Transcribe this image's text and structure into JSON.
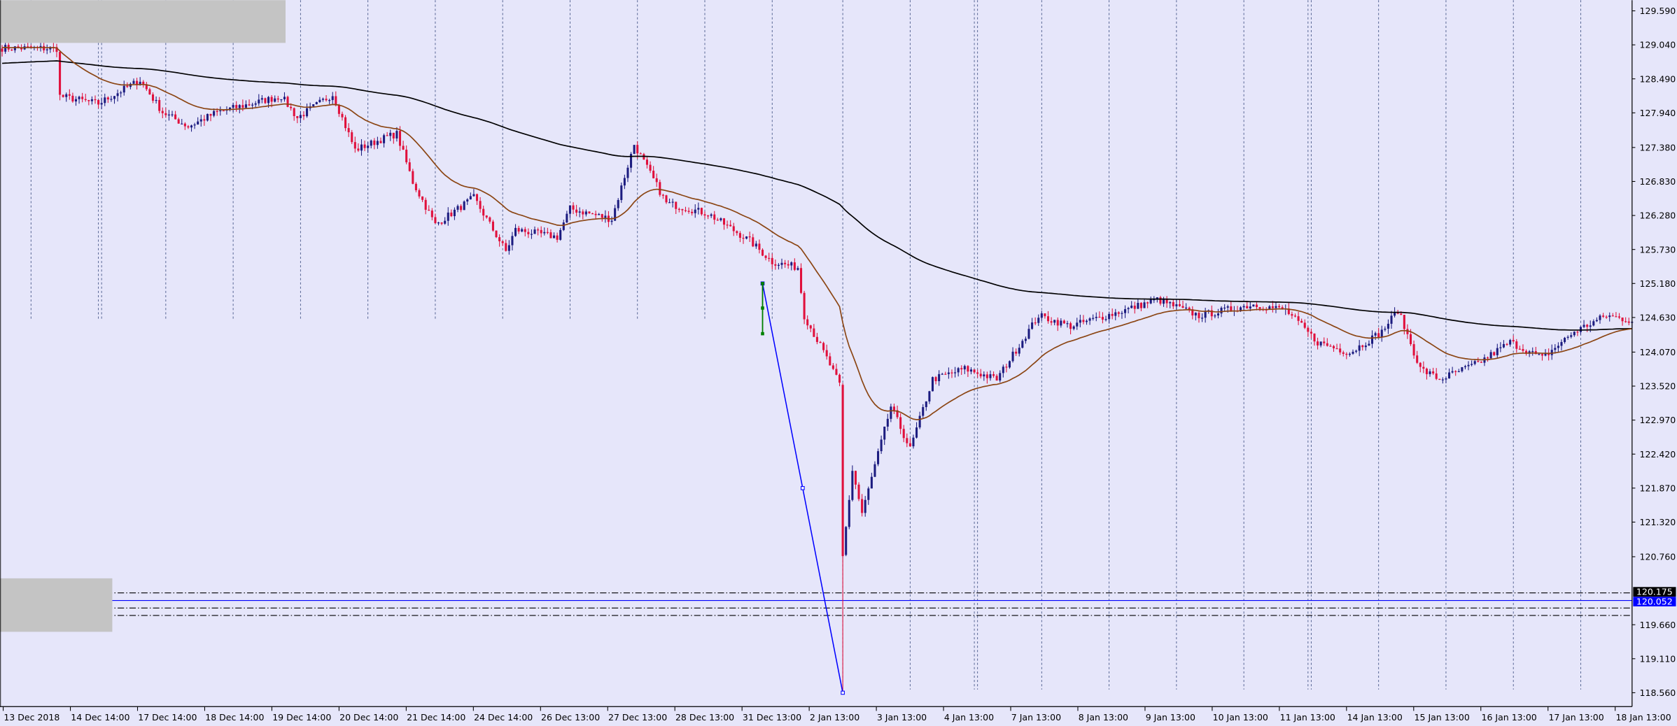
{
  "chart_data": {
    "type": "candlestick",
    "title": "",
    "colors": {
      "background": "#e6e6fa",
      "bull": "#1c1c80",
      "bear": "#e0103c",
      "ma_fast": "#8b4513",
      "ma_slow": "#000000",
      "trendline": "#0000ff",
      "marker": "#008000",
      "badge_black": "#000000",
      "badge_blue": "#0000ff"
    },
    "ylim": [
      118.56,
      129.59
    ],
    "y_ticks": [
      "129.590",
      "129.040",
      "128.490",
      "127.940",
      "127.380",
      "126.830",
      "126.280",
      "125.730",
      "125.180",
      "124.630",
      "124.070",
      "123.520",
      "122.970",
      "122.420",
      "121.870",
      "121.320",
      "120.760",
      "119.660",
      "119.110",
      "118.560"
    ],
    "x_ticks": [
      "13 Dec 2018",
      "14 Dec 14:00",
      "17 Dec 14:00",
      "18 Dec 14:00",
      "19 Dec 14:00",
      "20 Dec 14:00",
      "21 Dec 14:00",
      "24 Dec 14:00",
      "26 Dec 13:00",
      "27 Dec 13:00",
      "28 Dec 13:00",
      "31 Dec 13:00",
      "2 Jan 13:00",
      "3 Jan 13:00",
      "4 Jan 13:00",
      "7 Jan 13:00",
      "8 Jan 13:00",
      "9 Jan 13:00",
      "10 Jan 13:00",
      "11 Jan 13:00",
      "14 Jan 13:00",
      "15 Jan 13:00",
      "16 Jan 13:00",
      "17 Jan 13:00",
      "18 Jan 13:00"
    ],
    "bar_count": 509,
    "close_keypoints": [
      [
        0,
        128.99
      ],
      [
        17,
        128.98
      ],
      [
        18,
        128.21
      ],
      [
        30,
        128.09
      ],
      [
        43,
        128.47
      ],
      [
        50,
        127.95
      ],
      [
        58,
        127.72
      ],
      [
        67,
        127.95
      ],
      [
        87,
        128.21
      ],
      [
        92,
        127.86
      ],
      [
        103,
        128.24
      ],
      [
        110,
        127.34
      ],
      [
        120,
        127.55
      ],
      [
        123,
        127.6
      ],
      [
        128,
        126.82
      ],
      [
        135,
        126.13
      ],
      [
        147,
        126.57
      ],
      [
        157,
        125.7
      ],
      [
        160,
        126.05
      ],
      [
        173,
        125.93
      ],
      [
        177,
        126.39
      ],
      [
        190,
        126.22
      ],
      [
        197,
        127.43
      ],
      [
        207,
        126.48
      ],
      [
        220,
        126.31
      ],
      [
        233,
        125.87
      ],
      [
        240,
        125.53
      ],
      [
        248,
        125.44
      ],
      [
        250,
        124.66
      ],
      [
        257,
        123.97
      ],
      [
        261,
        123.54
      ],
      [
        262,
        120.77
      ],
      [
        265,
        122.16
      ],
      [
        268,
        121.46
      ],
      [
        277,
        123.19
      ],
      [
        283,
        122.5
      ],
      [
        290,
        123.63
      ],
      [
        300,
        123.8
      ],
      [
        310,
        123.63
      ],
      [
        323,
        124.66
      ],
      [
        333,
        124.49
      ],
      [
        350,
        124.75
      ],
      [
        360,
        124.92
      ],
      [
        373,
        124.66
      ],
      [
        390,
        124.84
      ],
      [
        400,
        124.75
      ],
      [
        410,
        124.23
      ],
      [
        420,
        124.06
      ],
      [
        430,
        124.4
      ],
      [
        435,
        124.75
      ],
      [
        442,
        123.8
      ],
      [
        448,
        123.63
      ],
      [
        460,
        123.89
      ],
      [
        470,
        124.23
      ],
      [
        480,
        123.97
      ],
      [
        490,
        124.4
      ],
      [
        500,
        124.66
      ],
      [
        508,
        124.58
      ]
    ],
    "spike_low": {
      "bar": 262,
      "open": 123.54,
      "low": 118.56,
      "close": 120.77
    },
    "ma_fast": {
      "period": 30,
      "seed": 129.0
    },
    "ma_slow": {
      "period": 200,
      "seed": 128.74
    },
    "trendline": {
      "start": {
        "bar": 237,
        "price": 125.18
      },
      "end": {
        "bar": 262,
        "price": 118.56
      }
    },
    "horizontal_levels": [
      {
        "price": 120.175,
        "style": "dash-dot",
        "label": "120.175",
        "badge": "black"
      },
      {
        "price": 120.052,
        "style": "solid",
        "label": "120.052",
        "badge": "blue"
      },
      {
        "price": 119.93,
        "style": "dash-dot"
      },
      {
        "price": 119.81,
        "style": "dash-dot"
      }
    ],
    "session_separator_bars_top": [
      9,
      30,
      31,
      51,
      72,
      93,
      114,
      135,
      156,
      177,
      198,
      219,
      240
    ],
    "session_separator_bars_full": [
      262,
      283,
      303,
      304,
      324,
      345,
      366,
      387,
      407,
      408,
      429,
      450,
      471,
      492
    ]
  }
}
